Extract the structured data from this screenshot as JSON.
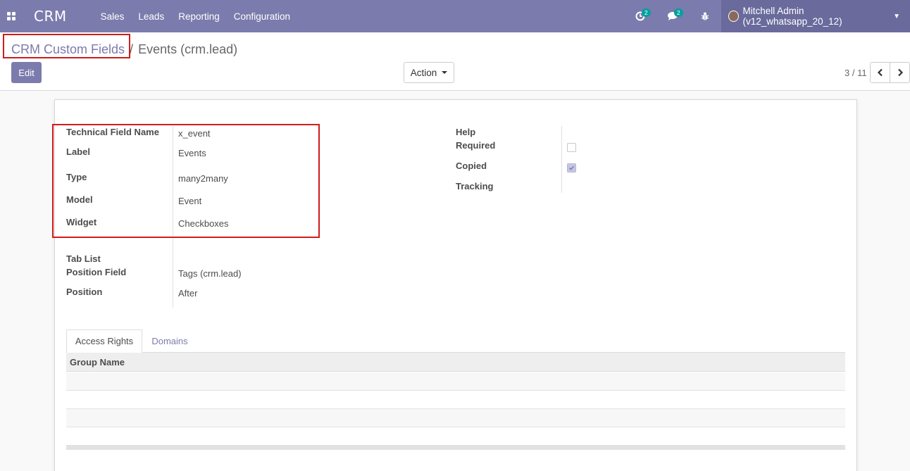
{
  "navbar": {
    "brand": "CRM",
    "menu": [
      "Sales",
      "Leads",
      "Reporting",
      "Configuration"
    ],
    "activity_badge": "2",
    "messages_badge": "2",
    "user": "Mitchell Admin (v12_whatsapp_20_12)"
  },
  "breadcrumb": {
    "parent": "CRM Custom Fields",
    "separator": "/",
    "current": "Events (crm.lead)"
  },
  "buttons": {
    "edit": "Edit",
    "action": "Action"
  },
  "pager": {
    "value": "3 / 11"
  },
  "form": {
    "left": [
      {
        "label": "Technical Field Name",
        "value": "x_event"
      },
      {
        "label": "Label",
        "value": "Events"
      },
      {
        "label": "Type",
        "value": "many2many"
      },
      {
        "label": "Model",
        "value": "Event"
      },
      {
        "label": "Widget",
        "value": "Checkboxes"
      },
      {
        "label": "Tab List",
        "value": ""
      },
      {
        "label": "Position Field",
        "value": "Tags (crm.lead)"
      },
      {
        "label": "Position",
        "value": "After"
      }
    ],
    "right": {
      "help_label": "Help",
      "required_label": "Required",
      "required_checked": false,
      "copied_label": "Copied",
      "copied_checked": true,
      "tracking_label": "Tracking"
    }
  },
  "notebook": {
    "tabs": [
      "Access Rights",
      "Domains"
    ],
    "active_tab": "Access Rights",
    "table": {
      "columns": [
        "Group Name"
      ]
    }
  },
  "colors": {
    "primary": "#7c7bad",
    "highlight": "#d01c1c",
    "badge": "#00a09d"
  }
}
